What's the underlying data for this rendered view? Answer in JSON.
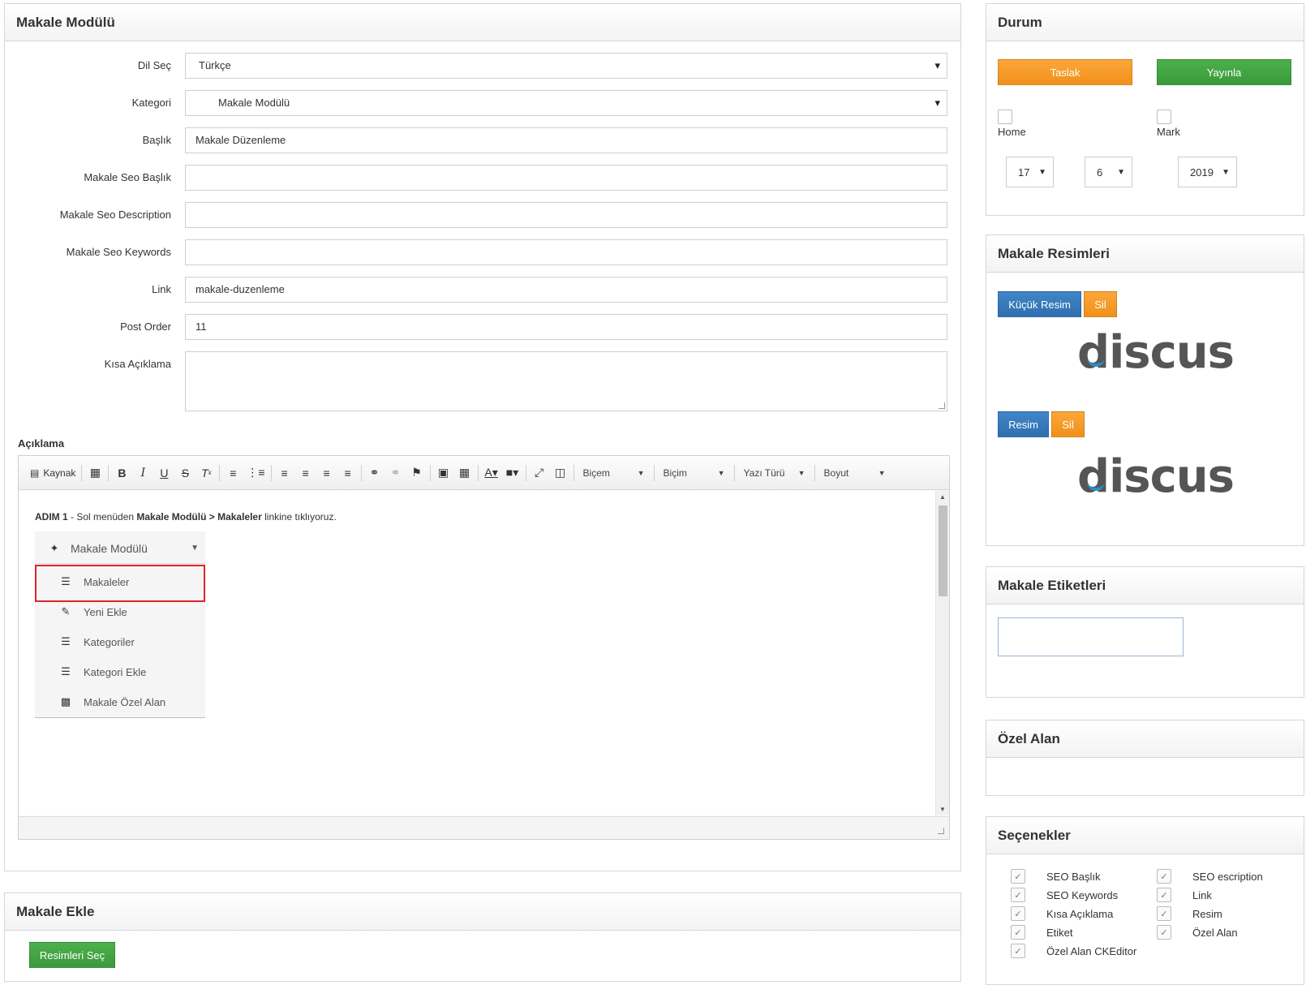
{
  "main": {
    "title": "Makale Modülü",
    "fields": {
      "dil": {
        "label": "Dil Seç",
        "value": "Türkçe"
      },
      "kategori": {
        "label": "Kategori",
        "value": "Makale Modülü"
      },
      "baslik": {
        "label": "Başlık",
        "value": "Makale Düzenleme"
      },
      "seo_baslik": {
        "label": "Makale Seo Başlık",
        "value": ""
      },
      "seo_desc": {
        "label": "Makale Seo Description",
        "value": ""
      },
      "seo_keywords": {
        "label": "Makale Seo Keywords",
        "value": ""
      },
      "link": {
        "label": "Link",
        "value": "makale-duzenleme"
      },
      "post_order": {
        "label": "Post Order",
        "value": "11"
      },
      "kisa": {
        "label": "Kısa Açıklama",
        "value": ""
      }
    },
    "aciklama_label": "Açıklama",
    "editor": {
      "toolbar": {
        "source": "Kaynak",
        "format": "Biçem",
        "style": "Biçim",
        "font": "Yazı Türü",
        "size": "Boyut"
      },
      "content": {
        "step_bold": "ADIM 1",
        "step_text1": " - Sol menüden ",
        "step_bold2": "Makale Modülü > Makaleler",
        "step_text2": " linkine tıklıyoruz.",
        "menu": {
          "head": "Makale Modülü",
          "items": [
            "Makaleler",
            "Yeni Ekle",
            "Kategoriler",
            "Kategori Ekle",
            "Makale Özel Alan"
          ]
        }
      }
    }
  },
  "ekle": {
    "title": "Makale Ekle",
    "button": "Resimleri Seç"
  },
  "durum": {
    "title": "Durum",
    "taslak": "Taslak",
    "yayinla": "Yayınla",
    "home": "Home",
    "mark": "Mark",
    "day": "17",
    "month": "6",
    "year": "2019"
  },
  "resimler": {
    "title": "Makale Resimleri",
    "small_btn": "Küçük Resim",
    "delete": "Sil",
    "big_btn": "Resim",
    "logo_text": "discus"
  },
  "etiketler": {
    "title": "Makale Etiketleri"
  },
  "ozel": {
    "title": "Özel Alan"
  },
  "secenekler": {
    "title": "Seçenekler",
    "left": [
      "SEO Başlık",
      "SEO Keywords",
      "Kısa Açıklama",
      "Etiket",
      "Özel Alan CKEditor"
    ],
    "right": [
      "SEO escription",
      "Link",
      "Resim",
      "Özel Alan"
    ]
  },
  "colors": {
    "orange": "#f39c1f",
    "green": "#3fa33f",
    "blue": "#337ab7",
    "highlight": "#e2222b"
  }
}
